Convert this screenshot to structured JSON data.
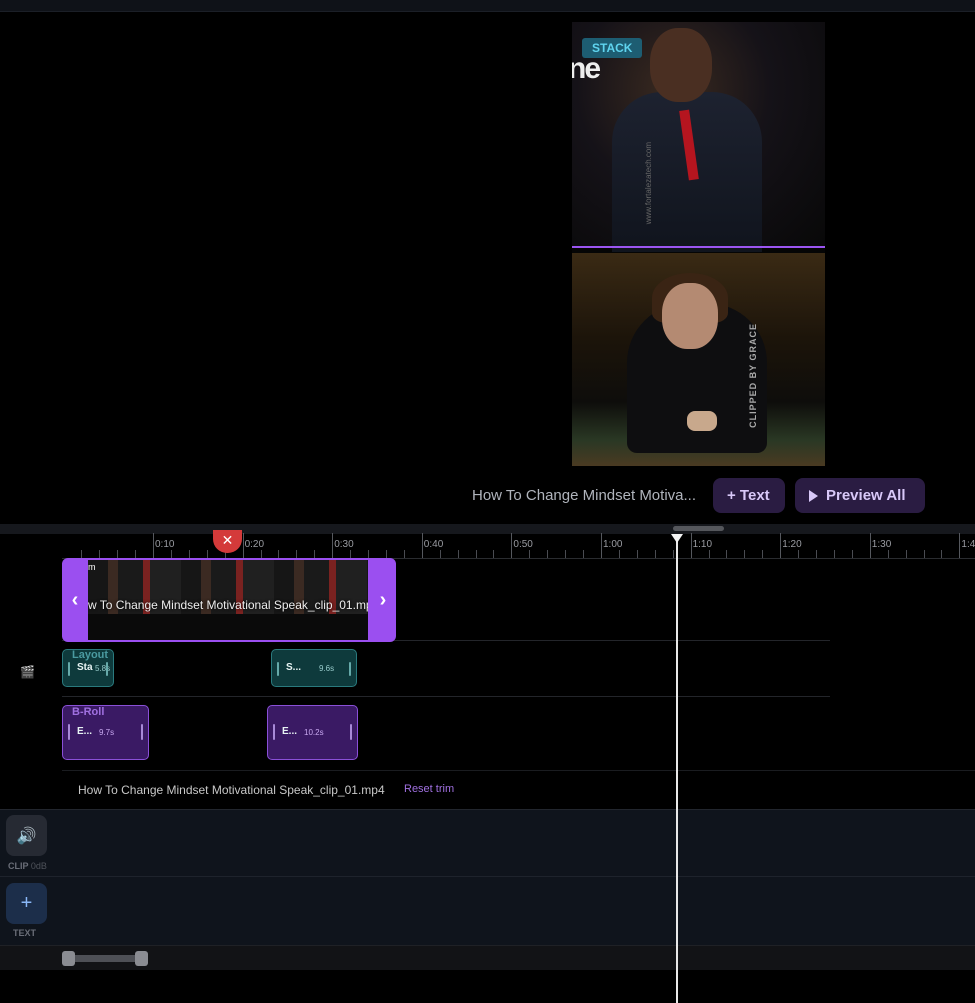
{
  "preview": {
    "stack_badge": "STACK",
    "top_video_logo_text": "ne",
    "top_video_side_text": "www.fortalezatech.com",
    "bottom_video_watermark": "CLIPPED BY GRACE",
    "clip_title": "How To Change Mindset Motiva...",
    "add_text_label": "+ Text",
    "preview_all_label": "Preview All"
  },
  "ruler": {
    "labels": [
      "0:10",
      "0:20",
      "0:30",
      "0:40",
      "0:50",
      "1:00",
      "1:10",
      "1:20",
      "1:30",
      "1:4"
    ]
  },
  "video_track": {
    "clip_name": "w To Change Mindset Motivational Speak_clip_01.mp4",
    "tag": "m",
    "left_handle": "‹",
    "right_handle": "›"
  },
  "layout_track": {
    "label": "Layout",
    "clips": [
      {
        "title": "Sta",
        "duration": "5.8s"
      },
      {
        "title": "S...",
        "duration": "9.6s"
      }
    ]
  },
  "broll_track": {
    "label": "B-Roll",
    "clips": [
      {
        "title": "E...",
        "duration": "9.7s"
      },
      {
        "title": "E...",
        "duration": "10.2s"
      }
    ]
  },
  "file_row": {
    "filename": "How To Change Mindset Motivational Speak_clip_01.mp4",
    "reset_trim": "Reset trim"
  },
  "tracks": {
    "clip_label": "CLIP",
    "clip_db": "0dB",
    "text_label": "TEXT"
  },
  "icons": {
    "film": "film-icon",
    "volume": "volume-icon",
    "plus": "plus-icon",
    "cut": "close-icon",
    "play": "play-icon"
  },
  "colors": {
    "accent": "#9b4ff0",
    "layout": "#2a7a7e",
    "broll": "#8a50d8",
    "cut_marker": "#d43a3a"
  }
}
